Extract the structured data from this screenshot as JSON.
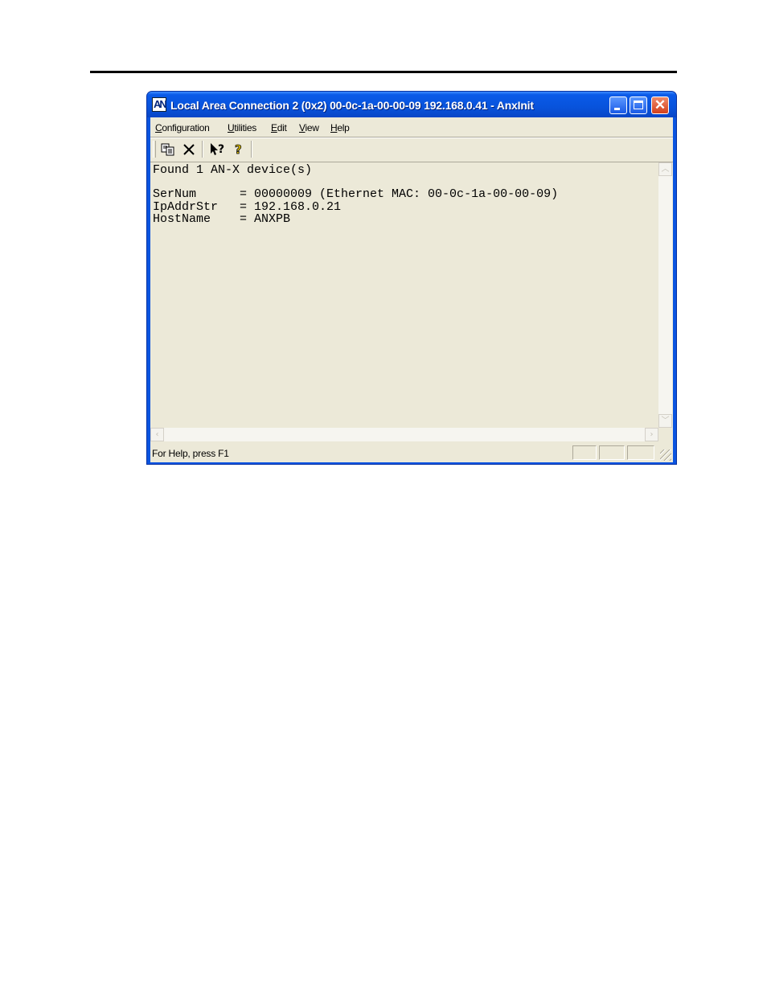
{
  "window": {
    "title": "Local Area Connection 2 (0x2) 00-0c-1a-00-00-09  192.168.0.41 - AnxInit",
    "icon_label": "AN",
    "controls": [
      "minimize-icon",
      "maximize-icon",
      "close-icon"
    ]
  },
  "menu": {
    "items": [
      {
        "first": "C",
        "rest": "onfiguration"
      },
      {
        "first": "U",
        "rest": "tilities"
      },
      {
        "first": "E",
        "rest": "dit"
      },
      {
        "first": "V",
        "rest": "iew"
      },
      {
        "first": "H",
        "rest": "elp"
      }
    ]
  },
  "toolbar": {
    "buttons": [
      "copy-icon",
      "clear-icon",
      "context-help-icon",
      "about-icon"
    ]
  },
  "output": {
    "lines": [
      "Found 1 AN-X device(s)",
      "",
      "SerNum      = 00000009 (Ethernet MAC: 00-0c-1a-00-00-09)",
      "IpAddrStr   = 192.168.0.21",
      "HostName    = ANXPB"
    ]
  },
  "status": {
    "text": "For Help, press F1"
  },
  "colors": {
    "titlebar": "#0a54e0",
    "client_bg": "#ece9d8",
    "close_button": "#d2401c"
  }
}
